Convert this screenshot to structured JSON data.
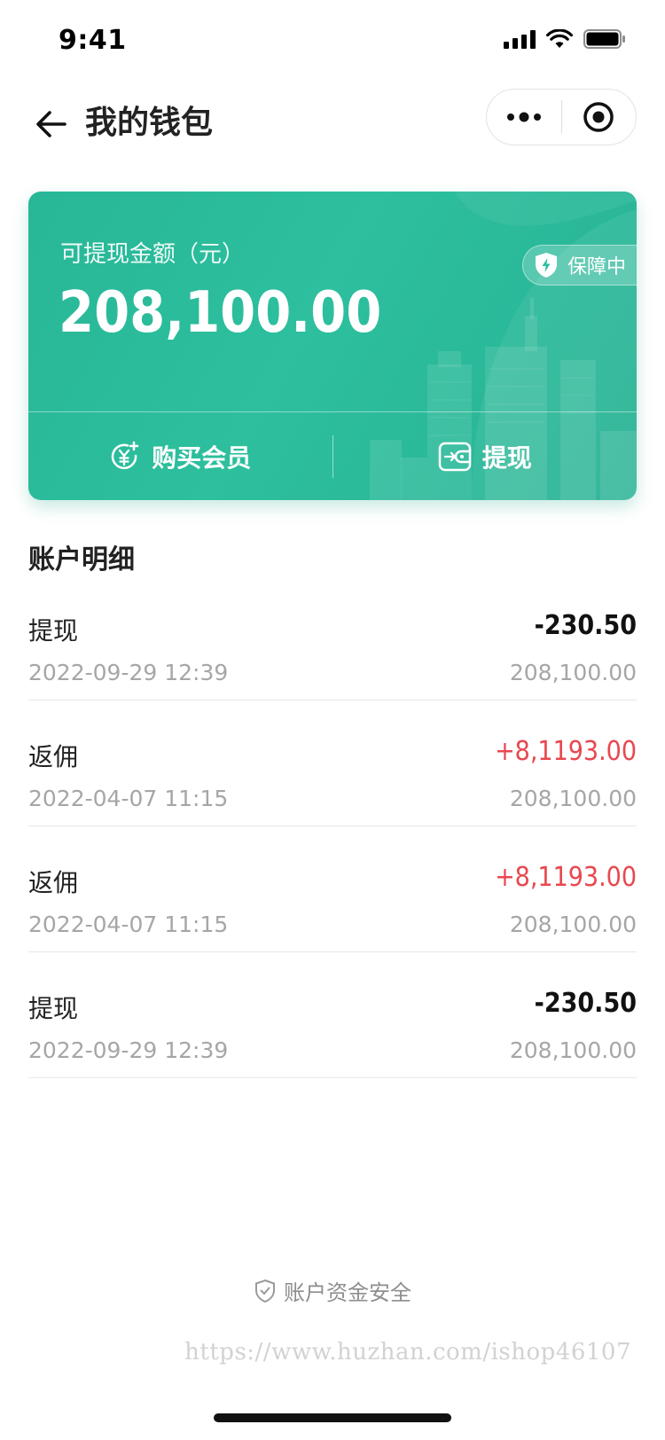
{
  "status_bar": {
    "time": "9:41"
  },
  "nav": {
    "title": "我的钱包"
  },
  "wallet": {
    "balance_label": "可提现金额（元）",
    "balance": "208,100.00",
    "badge": "保障中",
    "actions": [
      {
        "label": "购买会员",
        "icon": "yuan-plus-icon"
      },
      {
        "label": "提现",
        "icon": "wallet-out-icon"
      }
    ],
    "colors": {
      "card": "#2dbf9e",
      "positive": "#e8484f"
    }
  },
  "details": {
    "title": "账户明细",
    "transactions": [
      {
        "title": "提现",
        "date": "2022-09-29 12:39",
        "amount": "-230.50",
        "balance": "208,100.00",
        "type": "negative"
      },
      {
        "title": "返佣",
        "date": "2022-04-07 11:15",
        "amount": "+8,1193.00",
        "balance": "208,100.00",
        "type": "positive"
      },
      {
        "title": "返佣",
        "date": "2022-04-07 11:15",
        "amount": "+8,1193.00",
        "balance": "208,100.00",
        "type": "positive"
      },
      {
        "title": "提现",
        "date": "2022-09-29 12:39",
        "amount": "-230.50",
        "balance": "208,100.00",
        "type": "negative"
      }
    ]
  },
  "footer": {
    "safety_text": "账户资金安全",
    "watermark": "https://www.huzhan.com/ishop46107"
  }
}
